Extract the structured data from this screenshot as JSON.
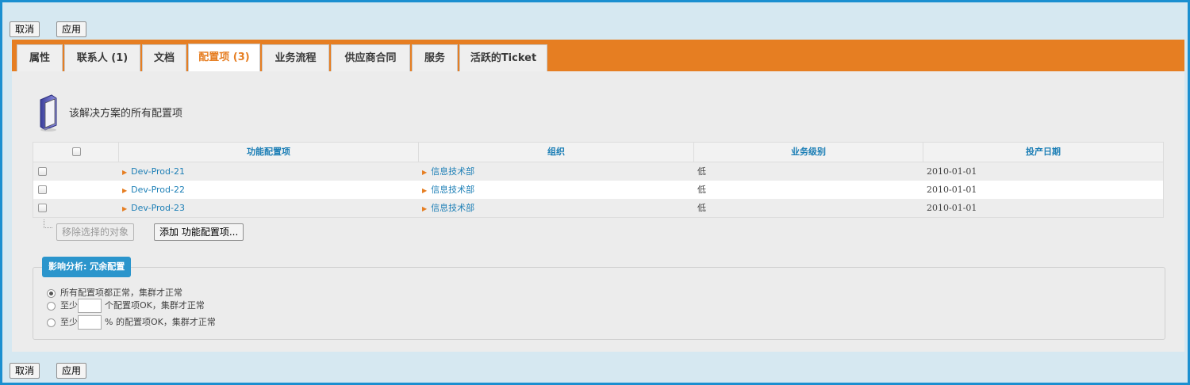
{
  "toolbar": {
    "cancel_label": "取消",
    "apply_label": "应用"
  },
  "tabs": [
    {
      "label": "属性"
    },
    {
      "label": "联系人 (1)"
    },
    {
      "label": "文档"
    },
    {
      "label": "配置项 (3)",
      "active": true
    },
    {
      "label": "业务流程"
    },
    {
      "label": "供应商合同"
    },
    {
      "label": "服务"
    },
    {
      "label": "活跃的Ticket"
    }
  ],
  "section": {
    "title": "该解决方案的所有配置项",
    "icon": "server-icon"
  },
  "table": {
    "columns": [
      "功能配置项",
      "组织",
      "业务级别",
      "投产日期"
    ],
    "rows": [
      {
        "ci": "Dev-Prod-21",
        "org": "信息技术部",
        "level": "低",
        "date": "2010-01-01"
      },
      {
        "ci": "Dev-Prod-22",
        "org": "信息技术部",
        "level": "低",
        "date": "2010-01-01"
      },
      {
        "ci": "Dev-Prod-23",
        "org": "信息技术部",
        "level": "低",
        "date": "2010-01-01"
      }
    ]
  },
  "actions": {
    "remove_label": "移除选择的对象",
    "add_label": "添加 功能配置项..."
  },
  "impact": {
    "legend": "影响分析: 冗余配置",
    "option_all": "所有配置项都正常，集群才正常",
    "option_count_prefix": "至少",
    "option_count_suffix": "个配置项OK，集群才正常",
    "option_percent_prefix": "至少",
    "option_percent_suffix": "% 的配置项OK，集群才正常",
    "selected": "all"
  },
  "colors": {
    "accent": "#e67e22",
    "brand_blue": "#1b8fd0",
    "link": "#1d7fb6"
  }
}
